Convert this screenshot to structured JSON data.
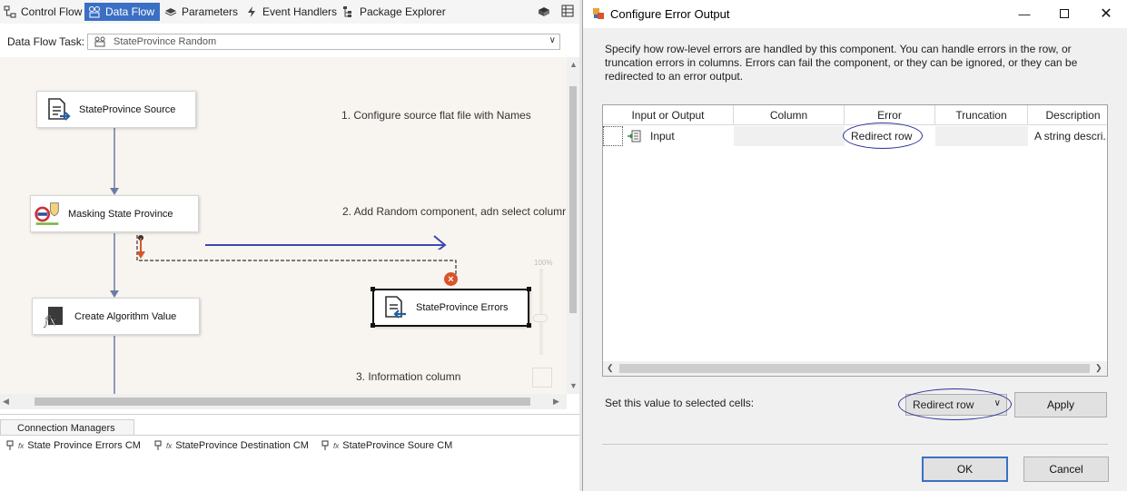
{
  "toolbar": {
    "tabs": [
      {
        "label": "Control Flow",
        "icon": "control-flow-icon",
        "active": false
      },
      {
        "label": "Data Flow",
        "icon": "data-flow-icon",
        "active": true
      },
      {
        "label": "Parameters",
        "icon": "parameters-icon",
        "active": false
      },
      {
        "label": "Event Handlers",
        "icon": "event-handlers-icon",
        "active": false
      },
      {
        "label": "Package Explorer",
        "icon": "package-explorer-icon",
        "active": false
      }
    ]
  },
  "task": {
    "label": "Data Flow Task:",
    "value": "StateProvince Random"
  },
  "canvas": {
    "components": {
      "source": "StateProvince Source",
      "masking": "Masking State Province",
      "algorithm": "Create Algorithm Value",
      "errors": "StateProvince Errors"
    },
    "annotations": {
      "step1": "1. Configure source flat file with Names",
      "step2": "2. Add Random component, adn select columr",
      "step3": "3. Information column"
    },
    "zoom": "100%"
  },
  "connection_managers": {
    "tab": "Connection Managers",
    "items": [
      "State Province Errors CM",
      "StateProvince Destination CM",
      "StateProvince Soure CM"
    ]
  },
  "dialog": {
    "title": "Configure Error Output",
    "description": "Specify how row-level errors are handled by this component. You can handle errors in the row, or truncation errors in columns. Errors can fail the component, or they can be ignored, or they can be redirected to an error output.",
    "grid": {
      "headers": [
        "Input or Output",
        "Column",
        "Error",
        "Truncation",
        "Description"
      ],
      "row": {
        "input": "Input",
        "column": "",
        "error": "Redirect row",
        "truncation": "",
        "description": "A string descri..."
      }
    },
    "set_label": "Set this value to selected cells:",
    "set_value": "Redirect row",
    "apply": "Apply",
    "ok": "OK",
    "cancel": "Cancel"
  },
  "colors": {
    "accent": "#3b6fc4",
    "annotation_arrow": "#3f47b5",
    "error_red": "#d9542b",
    "highlight_ellipse": "#2c2f9a"
  }
}
